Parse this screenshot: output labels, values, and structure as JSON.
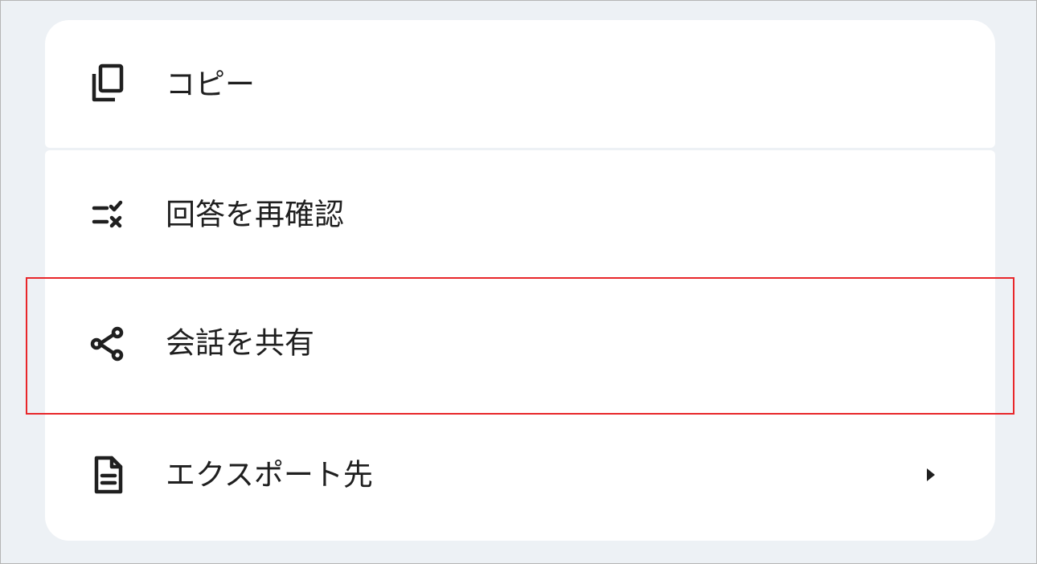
{
  "menu": {
    "items": [
      {
        "label": "コピー",
        "icon": "copy-icon"
      },
      {
        "label": "回答を再確認",
        "icon": "double-check-icon"
      },
      {
        "label": "会話を共有",
        "icon": "share-icon"
      },
      {
        "label": "エクスポート先",
        "icon": "document-icon",
        "has_submenu": true
      }
    ]
  },
  "colors": {
    "background": "#edf1f5",
    "card": "#ffffff",
    "text": "#1f1f1f",
    "highlight": "#e8262a"
  }
}
